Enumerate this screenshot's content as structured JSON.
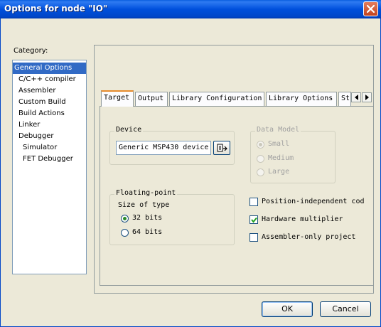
{
  "window": {
    "title": "Options for node \"IO\""
  },
  "category": {
    "label": "Category:",
    "items": [
      {
        "label": "General Options",
        "selected": true
      },
      {
        "label": "C/C++ compiler"
      },
      {
        "label": "Assembler"
      },
      {
        "label": "Custom Build"
      },
      {
        "label": "Build Actions"
      },
      {
        "label": "Linker"
      },
      {
        "label": "Debugger"
      },
      {
        "label": "Simulator"
      },
      {
        "label": "FET Debugger"
      }
    ]
  },
  "tabs": [
    "Target",
    "Output",
    "Library Configuration",
    "Library Options",
    "St"
  ],
  "device": {
    "group_title": "Device",
    "value": "Generic MSP430 device"
  },
  "data_model": {
    "group_title": "Data Model",
    "options": [
      "Small",
      "Medium",
      "Large"
    ],
    "selected": "Small"
  },
  "floating_point": {
    "group_title": "Floating-point",
    "size_label": "Size of type",
    "options": [
      "32 bits",
      "64 bits"
    ],
    "selected": "32 bits"
  },
  "checkboxes": [
    {
      "label": "Position-independent cod",
      "checked": false
    },
    {
      "label": "Hardware multiplier",
      "checked": true
    },
    {
      "label": "Assembler-only project",
      "checked": false
    }
  ],
  "buttons": {
    "ok": "OK",
    "cancel": "Cancel"
  },
  "colors": {
    "titlebar": "#0050dc",
    "selection": "#316ac5",
    "active_tab": "#e68b2c",
    "dialog_bg": "#ece9d8"
  }
}
